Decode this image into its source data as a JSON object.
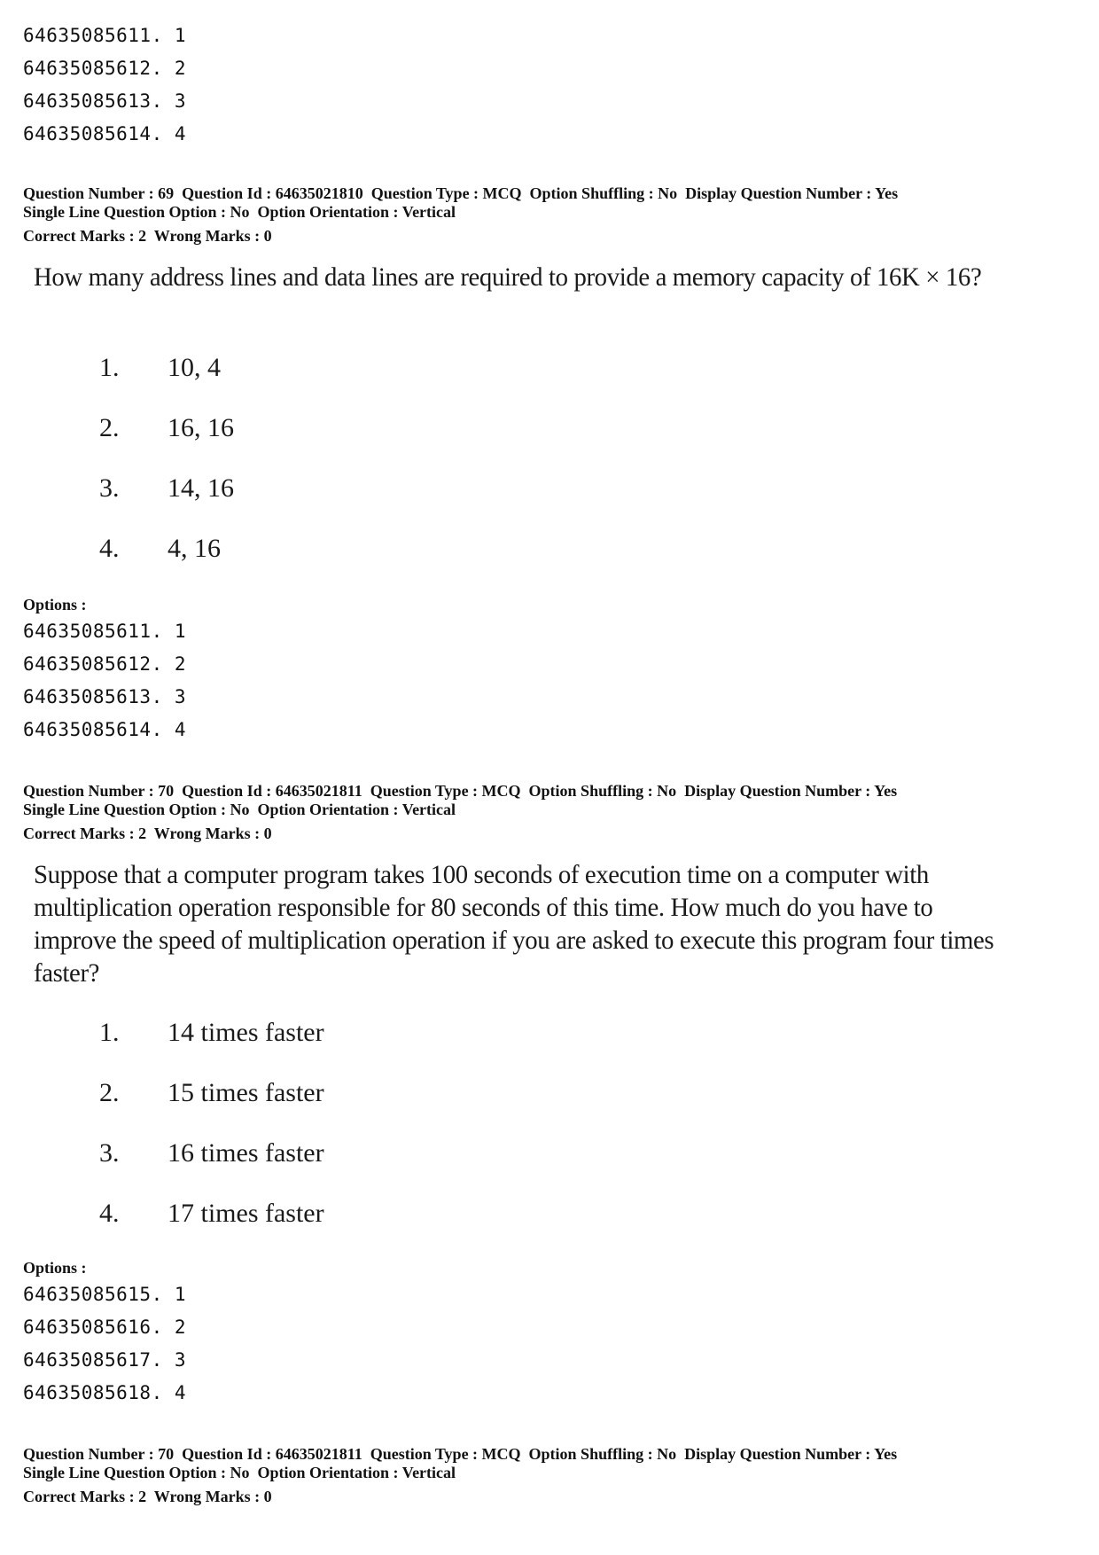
{
  "top_options": {
    "codes": [
      "64635085611. 1",
      "64635085612. 2",
      "64635085613. 3",
      "64635085614. 4"
    ]
  },
  "questions": [
    {
      "meta_line1": "Question Number : 69  Question Id : 64635021810  Question Type : MCQ  Option Shuffling : No  Display Question Number : Yes",
      "meta_line2": "Single Line Question Option : No  Option Orientation : Vertical",
      "marks": "Correct Marks : 2  Wrong Marks : 0",
      "text": "How many address lines and data lines are required to provide a memory capacity of 16K × 16?",
      "choices": [
        {
          "num": "1.",
          "text": "10, 4"
        },
        {
          "num": "2.",
          "text": "16, 16"
        },
        {
          "num": "3.",
          "text": "14, 16"
        },
        {
          "num": "4.",
          "text": "4, 16"
        }
      ],
      "options_label": "Options :",
      "option_codes": [
        "64635085611. 1",
        "64635085612. 2",
        "64635085613. 3",
        "64635085614. 4"
      ]
    },
    {
      "meta_line1": "Question Number : 70  Question Id : 64635021811  Question Type : MCQ  Option Shuffling : No  Display Question Number : Yes",
      "meta_line2": "Single Line Question Option : No  Option Orientation : Vertical",
      "marks": "Correct Marks : 2  Wrong Marks : 0",
      "text": "Suppose that a computer program takes 100 seconds of execution time on a computer with multiplication operation responsible for 80 seconds of this time. How much do you have to improve the speed of multiplication operation if you are asked to execute this program four times faster?",
      "choices": [
        {
          "num": "1.",
          "text": "14 times faster"
        },
        {
          "num": "2.",
          "text": "15 times faster"
        },
        {
          "num": "3.",
          "text": "16 times faster"
        },
        {
          "num": "4.",
          "text": "17 times faster"
        }
      ],
      "options_label": "Options :",
      "option_codes": [
        "64635085615. 1",
        "64635085616. 2",
        "64635085617. 3",
        "64635085618. 4"
      ]
    },
    {
      "meta_line1": "Question Number : 70  Question Id : 64635021811  Question Type : MCQ  Option Shuffling : No  Display Question Number : Yes",
      "meta_line2": "Single Line Question Option : No  Option Orientation : Vertical",
      "marks": "Correct Marks : 2  Wrong Marks : 0"
    }
  ]
}
